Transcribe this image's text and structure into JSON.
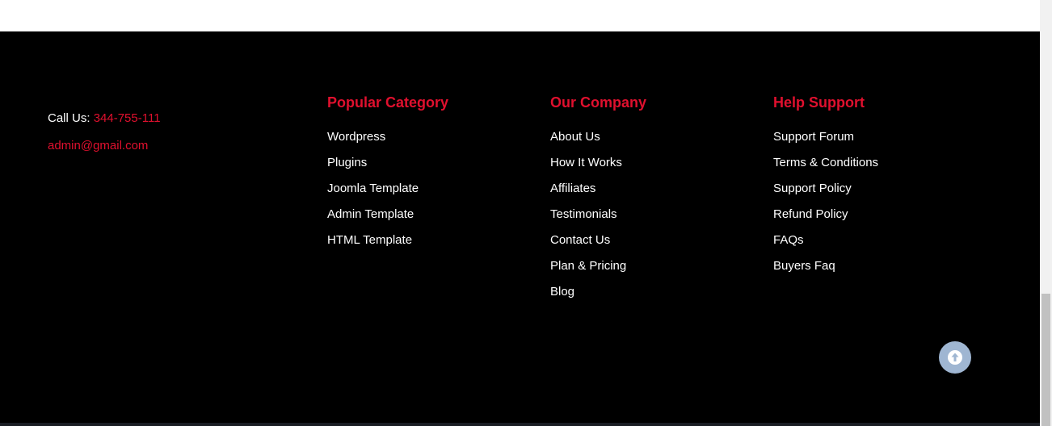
{
  "contact": {
    "call_label": "Call Us:",
    "phone": "344-755-111",
    "email": "admin@gmail.com"
  },
  "columns": [
    {
      "title": "Popular Category",
      "items": [
        "Wordpress",
        "Plugins",
        "Joomla Template",
        "Admin Template",
        "HTML Template"
      ]
    },
    {
      "title": "Our Company",
      "items": [
        "About Us",
        "How It Works",
        "Affiliates",
        "Testimonials",
        "Contact Us",
        "Plan & Pricing",
        "Blog"
      ]
    },
    {
      "title": "Help Support",
      "items": [
        "Support Forum",
        "Terms & Conditions",
        "Support Policy",
        "Refund Policy",
        "FAQs",
        "Buyers Faq"
      ]
    }
  ],
  "icons": {
    "back_to_top": "arrow-up-icon"
  },
  "colors": {
    "footer_bg": "#000000",
    "accent": "#e0102e",
    "link": "#ffffff",
    "back_to_top_bg": "#9fb6d2"
  }
}
